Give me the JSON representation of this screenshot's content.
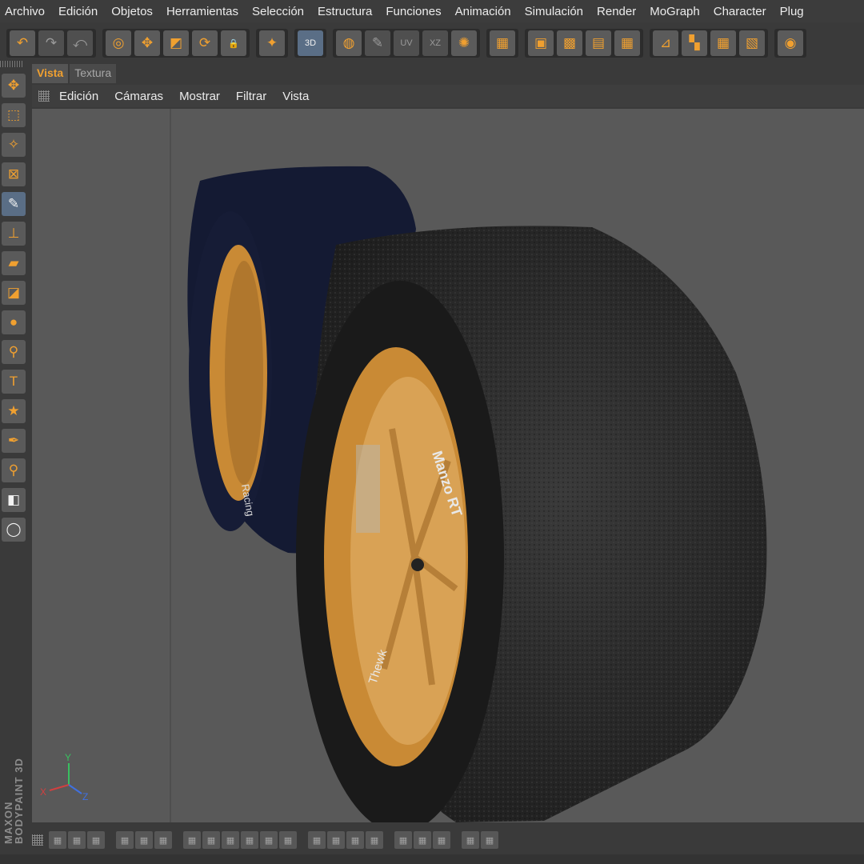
{
  "menu": [
    "Archivo",
    "Edición",
    "Objetos",
    "Herramientas",
    "Selección",
    "Estructura",
    "Funciones",
    "Animación",
    "Simulación",
    "Render",
    "MoGraph",
    "Character",
    "Plug"
  ],
  "toolbar": {
    "groups": [
      [
        {
          "icon": "undo-icon",
          "glyph": "↶"
        },
        {
          "icon": "redo-icon",
          "glyph": "↷",
          "dim": true
        },
        {
          "icon": "history-icon",
          "glyph": "⤺",
          "dim": true
        }
      ],
      [
        {
          "icon": "select-icon",
          "glyph": "◎"
        },
        {
          "icon": "move-icon",
          "glyph": "✥"
        },
        {
          "icon": "scale-icon",
          "glyph": "◩"
        },
        {
          "icon": "rotate-icon",
          "glyph": "⟳"
        },
        {
          "icon": "lock-icon",
          "glyph": "🔒"
        }
      ],
      [
        {
          "icon": "paint-sparkle-icon",
          "glyph": "✦"
        }
      ],
      [
        {
          "icon": "paint-3d-icon",
          "glyph": "3D",
          "active": true
        }
      ],
      [
        {
          "icon": "texture-sphere-icon",
          "glyph": "◍"
        },
        {
          "icon": "paint-off-icon",
          "glyph": "✎",
          "dim": true
        },
        {
          "icon": "uv-icon",
          "glyph": "UV",
          "dim": true
        },
        {
          "icon": "xz-icon",
          "glyph": "XZ",
          "dim": true
        },
        {
          "icon": "wheel-icon",
          "glyph": "✺"
        }
      ],
      [
        {
          "icon": "clapper-icon",
          "glyph": "▦"
        }
      ],
      [
        {
          "icon": "checker-layer-icon",
          "glyph": "▣"
        },
        {
          "icon": "checker-grid-icon",
          "glyph": "▩"
        },
        {
          "icon": "checker-arrow-icon",
          "glyph": "▤"
        },
        {
          "icon": "checker-icon",
          "glyph": "▦"
        }
      ],
      [
        {
          "icon": "axis-icon",
          "glyph": "⊿"
        },
        {
          "icon": "quad-view-icon",
          "glyph": "▚"
        },
        {
          "icon": "grid-view-icon",
          "glyph": "▦"
        },
        {
          "icon": "grid-plus-icon",
          "glyph": "▧"
        }
      ],
      [
        {
          "icon": "render-view-icon",
          "glyph": "◉"
        }
      ]
    ]
  },
  "left_tools": [
    {
      "icon": "move-tool-icon",
      "glyph": "✥"
    },
    {
      "icon": "rect-select-icon",
      "glyph": "⬚"
    },
    {
      "icon": "magic-wand-icon",
      "glyph": "✧"
    },
    {
      "icon": "transform-icon",
      "glyph": "⊠"
    },
    {
      "icon": "brush-icon",
      "glyph": "✎",
      "active": true
    },
    {
      "icon": "stamp-icon",
      "glyph": "⊥"
    },
    {
      "icon": "eraser-icon",
      "glyph": "▰"
    },
    {
      "icon": "gradient-icon",
      "glyph": "◪"
    },
    {
      "icon": "drop-icon",
      "glyph": "●"
    },
    {
      "icon": "zoom-icon",
      "glyph": "⚲"
    },
    {
      "icon": "text-icon",
      "glyph": "T"
    },
    {
      "icon": "star-icon",
      "glyph": "★"
    },
    {
      "icon": "pipette-icon",
      "glyph": "✒"
    },
    {
      "icon": "magnifier-pen-icon",
      "glyph": "⚲"
    },
    {
      "icon": "color-swatch-icon",
      "glyph": "◧",
      "white": true
    },
    {
      "icon": "circle-icon",
      "glyph": "◯",
      "white": true
    }
  ],
  "panel_tabs": [
    {
      "label": "Vista",
      "active": true
    },
    {
      "label": "Textura",
      "active": false
    }
  ],
  "view_menu": [
    "Edición",
    "Cámaras",
    "Mostrar",
    "Filtrar",
    "Vista"
  ],
  "branding": "MAXON\nBODYPAINT 3D",
  "axis": {
    "x": "X",
    "y": "Y",
    "z": "Z"
  },
  "tire_text": {
    "front_sidewall": "Manzo RT",
    "front_lower": "Thewk",
    "back_sidewall": "Racing"
  },
  "colors": {
    "rim": "#c98a35",
    "tire": "#222",
    "back_tire": "#141a33",
    "viewport": "#595959",
    "accent": "#f0a030"
  },
  "bottom_groups": [
    3,
    3,
    6,
    4,
    3,
    2
  ]
}
